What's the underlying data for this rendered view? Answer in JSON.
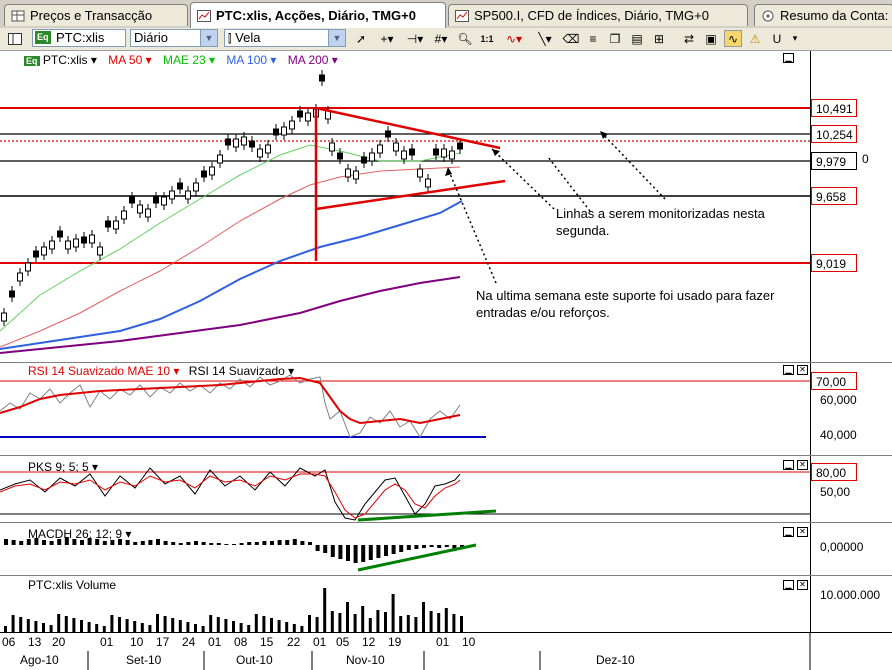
{
  "tabs": [
    {
      "label": "Preços e Transacção",
      "icon": "table-icon"
    },
    {
      "label": "PTC:xlis, Acções, Diário, TMG+0",
      "icon": "chart-icon",
      "active": true
    },
    {
      "label": "SP500.I, CFD de Índices, Diário, TMG+0",
      "icon": "chart-icon"
    },
    {
      "label": "Resumo da Conta:",
      "icon": "account-icon"
    }
  ],
  "toolbar": {
    "symbol": "PTC:xlis",
    "interval": "Diário",
    "chart_style": "Vela"
  },
  "main_pane": {
    "indicators": [
      {
        "label": "PTC:xlis",
        "color": "#000000"
      },
      {
        "label": "MA 50",
        "color": "#e00000"
      },
      {
        "label": "MAE 23",
        "color": "#00c000"
      },
      {
        "label": "MA 100",
        "color": "#3060e0"
      },
      {
        "label": "MA 200",
        "color": "#800080"
      }
    ],
    "price_levels": [
      "10,491",
      "10,254",
      "9,979",
      "9,658",
      "9,019"
    ],
    "hidden_label": "0",
    "annotation1": "Linhas a serem monitorizadas nesta segunda.",
    "annotation2": "Na ultima semana este suporte foi usado para fazer entradas e/ou reforços."
  },
  "rsi_pane": {
    "title_red": "RSI 14 Suavizado MAE 10",
    "title_black": "RSI 14 Suavizado",
    "levels": [
      "70,00",
      "60,000",
      "40,000"
    ]
  },
  "pks_pane": {
    "title": "PKS 9; 5; 5",
    "levels": [
      "80,00",
      "50,00"
    ]
  },
  "macd_pane": {
    "title": "MACDH 26; 12; 9",
    "levels": [
      "0,00000"
    ]
  },
  "volume_pane": {
    "title": "PTC:xlis Volume",
    "levels": [
      "10.000.000"
    ]
  },
  "date_axis": {
    "days": [
      "06",
      "13",
      "20",
      "01",
      "10",
      "17",
      "24",
      "01",
      "08",
      "15",
      "22",
      "01",
      "05",
      "12",
      "19",
      "01",
      "10"
    ],
    "months": [
      "Ago-10",
      "Set-10",
      "Out-10",
      "Nov-10",
      "Dez-10"
    ]
  },
  "colors": {
    "support_line": "#e00000",
    "trend_line": "#008000"
  }
}
